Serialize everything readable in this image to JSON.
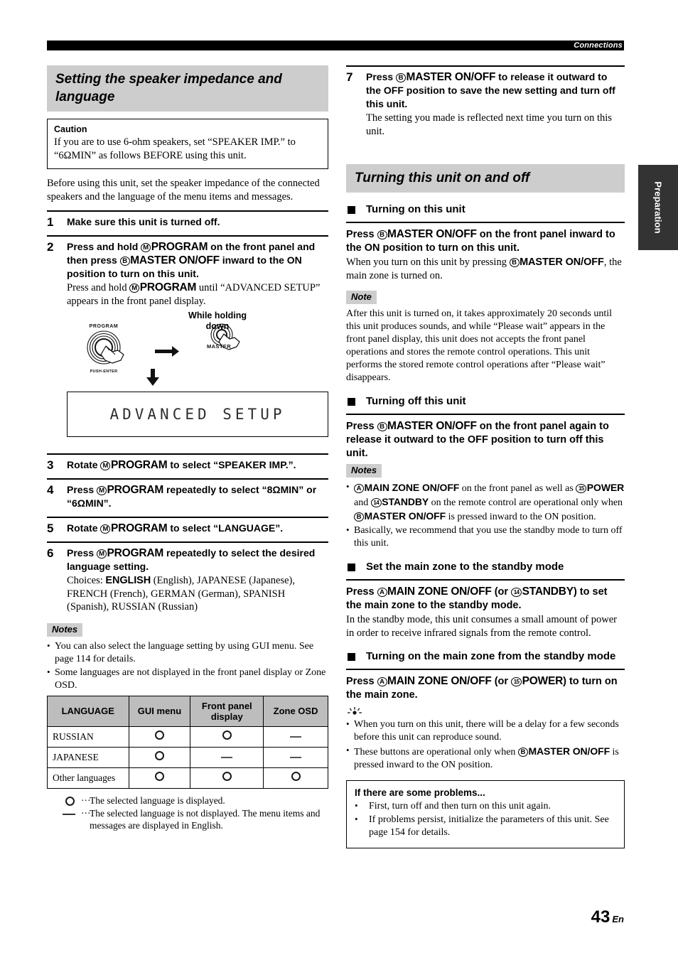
{
  "header": {
    "running_title": "Connections"
  },
  "side_tab": {
    "label": "Preparation"
  },
  "page_number": {
    "number": "43",
    "suffix": "En"
  },
  "left_column": {
    "section_title": "Setting the speaker impedance and language",
    "caution": {
      "title": "Caution",
      "text_a": "If you are to use 6-ohm speakers, set “SPEAKER IMP.” to",
      "text_b": "“6ΩMIN” as follows BEFORE using this unit."
    },
    "intro": "Before using this unit, set the speaker impedance of the connected speakers and the language of the menu items and messages.",
    "steps": [
      {
        "num": "1",
        "lead": "Make sure this unit is turned off."
      },
      {
        "num": "2",
        "lead_parts": {
          "p1": "Press and hold ",
          "marker1": "M",
          "key1": "PROGRAM",
          "p2": " on the front panel and then press ",
          "marker2": "B",
          "key2": "MASTER ON/OFF",
          "p3": " inward to the ON position to turn on this unit."
        },
        "sub_parts": {
          "s1": "Press and hold ",
          "marker": "M",
          "key": "PROGRAM",
          "s2": " until “ADVANCED SETUP” appears in the front panel display."
        }
      },
      {
        "num": "3",
        "lead_parts": {
          "p1": "Rotate ",
          "marker": "M",
          "key": "PROGRAM",
          "p2": " to select “SPEAKER IMP.”."
        }
      },
      {
        "num": "4",
        "lead_parts": {
          "p1": "Press ",
          "marker": "M",
          "key": "PROGRAM",
          "p2": " repeatedly to select “8ΩMIN” or “6ΩMIN”."
        }
      },
      {
        "num": "5",
        "lead_parts": {
          "p1": "Rotate ",
          "marker": "M",
          "key": "PROGRAM",
          "p2": " to select “LANGUAGE”."
        }
      },
      {
        "num": "6",
        "lead_parts": {
          "p1": "Press ",
          "marker": "M",
          "key": "PROGRAM",
          "p2": " repeatedly to select the desired language setting."
        },
        "choices_label": "Choices:",
        "choices_bold": "ENGLISH",
        "choices_rest": " (English), JAPANESE (Japanese), FRENCH (French), GERMAN (German), SPANISH (Spanish), RUSSIAN (Russian)"
      }
    ],
    "diagram": {
      "knob_top_label": "PROGRAM",
      "knob_bottom_label": "PUSH-ENTER",
      "while_holding_line1": "While holding",
      "while_holding_line2": "down",
      "button_label": "MASTER",
      "display_text": "ADVANCED SETUP"
    },
    "notes_tag": "Notes",
    "notes": [
      "You can also select the language setting by using GUI menu. See page 114 for details.",
      "Some languages are not displayed in the front panel display or Zone OSD."
    ],
    "table": {
      "headers": [
        "LANGUAGE",
        "GUI menu",
        "Front panel display",
        "Zone OSD"
      ],
      "rows": [
        {
          "language": "RUSSIAN",
          "gui": "o",
          "front": "o",
          "zone": "-"
        },
        {
          "language": "JAPANESE",
          "gui": "o",
          "front": "-",
          "zone": "-"
        },
        {
          "language": "Other languages",
          "gui": "o",
          "front": "o",
          "zone": "o"
        }
      ]
    },
    "legend": {
      "dots": "···",
      "circle_text": "The selected language is displayed.",
      "dash_text": "The selected language is not displayed. The menu items and messages are displayed in English."
    }
  },
  "right_column": {
    "step7": {
      "num": "7",
      "lead_parts": {
        "p1": "Press ",
        "marker": "B",
        "key": "MASTER ON/OFF",
        "p2": " to release it outward to the OFF position to save the new setting and turn off this unit."
      },
      "sub": "The setting you made is reflected next time you turn on this unit."
    },
    "section_title": "Turning this unit on and off",
    "turning_on": {
      "subhead": "Turning on this unit",
      "lead_parts": {
        "p1": "Press ",
        "marker": "B",
        "key": "MASTER ON/OFF",
        "p2": " on the front panel inward to the ON position to turn on this unit."
      },
      "after_parts": {
        "a1": "When you turn on this unit by pressing ",
        "marker": "B",
        "key": "MASTER ON/OFF",
        "a2": ", the main zone is turned on."
      },
      "note_tag": "Note",
      "note": "After this unit is turned on, it takes approximately 20 seconds until this unit produces sounds, and while “Please wait” appears in the front panel display, this unit does not accepts the front panel operations and stores the remote control operations. This unit performs the stored remote control operations after “Please wait” disappears."
    },
    "turning_off": {
      "subhead": "Turning off this unit",
      "lead_parts": {
        "p1": "Press ",
        "marker": "B",
        "key": "MASTER ON/OFF",
        "p2": " on the front panel again to release it outward to the OFF position to turn off this unit."
      },
      "notes_tag": "Notes",
      "note1_parts": {
        "m1": "A",
        "k1": "MAIN ZONE ON/OFF",
        "t1": " on the front panel as well as ",
        "m2": "15",
        "k2": "POWER",
        "t2": " and ",
        "m3": "14",
        "k3": "STANDBY",
        "t3": " on the remote control are operational only when ",
        "m4": "B",
        "k4": "MASTER ON/OFF",
        "t4": " is pressed inward to the ON position."
      },
      "note2": "Basically, we recommend that you use the standby mode to turn off this unit."
    },
    "standby": {
      "subhead": "Set the main zone to the standby mode",
      "lead_parts": {
        "p1": "Press ",
        "m1": "A",
        "k1": "MAIN ZONE ON/OFF",
        "p2": " (or ",
        "m2": "14",
        "k2": "STANDBY",
        "p3": ") to set the main zone to the standby mode."
      },
      "after": "In the standby mode, this unit consumes a small amount of power in order to receive infrared signals from the remote control."
    },
    "turn_on_main": {
      "subhead": "Turning on the main zone from the standby mode",
      "lead_parts": {
        "p1": "Press ",
        "m1": "A",
        "k1": "MAIN ZONE ON/OFF",
        "p2": " (or ",
        "m2": "15",
        "k2": "POWER",
        "p3": ") to turn on the main zone."
      },
      "tips": [
        "When you turn on this unit, there will be a delay for a few seconds before this unit can reproduce sound."
      ],
      "tip2_parts": {
        "t1": "These buttons are operational only when ",
        "m": "B",
        "k": "MASTER ON/OFF",
        "t2": " is pressed inward to the ON position."
      }
    },
    "problems_box": {
      "title": "If there are some problems...",
      "items": [
        "First, turn off and then turn on this unit again.",
        "If problems persist, initialize the parameters of this unit. See page 154 for details."
      ]
    }
  },
  "colors": {
    "section_band": "#cdcdcd",
    "tab_bg": "#333333",
    "table_header": "#bdbdbd",
    "rule": "#000000"
  }
}
